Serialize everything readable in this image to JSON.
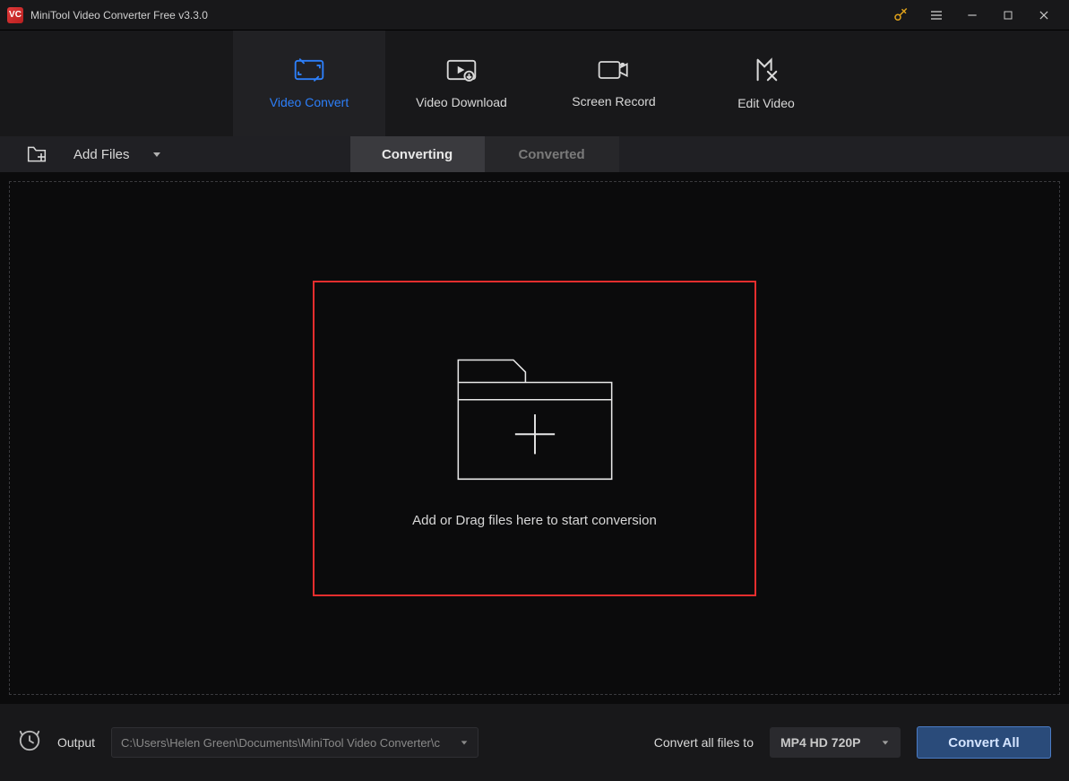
{
  "titlebar": {
    "app_title": "MiniTool Video Converter Free v3.3.0"
  },
  "maintabs": {
    "items": [
      {
        "label": "Video Convert"
      },
      {
        "label": "Video Download"
      },
      {
        "label": "Screen Record"
      },
      {
        "label": "Edit Video"
      }
    ]
  },
  "toolbar": {
    "add_files_label": "Add Files",
    "subtabs": [
      {
        "label": "Converting"
      },
      {
        "label": "Converted"
      }
    ]
  },
  "main": {
    "drop_label": "Add or Drag files here to start conversion"
  },
  "footer": {
    "output_label": "Output",
    "output_path": "C:\\Users\\Helen Green\\Documents\\MiniTool Video Converter\\c",
    "convert_all_label": "Convert all files to",
    "format_label": "MP4 HD 720P",
    "convert_btn_label": "Convert All"
  },
  "colors": {
    "accent_blue": "#2d7ff9",
    "highlight_red": "#e62e2e",
    "key_gold": "#e0a21a"
  }
}
